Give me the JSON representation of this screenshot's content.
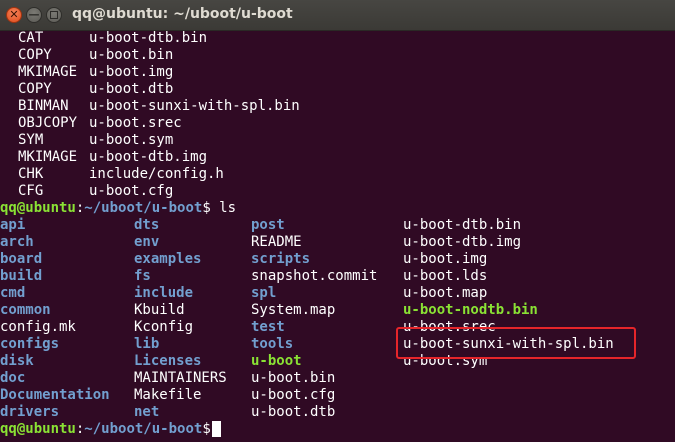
{
  "window": {
    "title": "qq@ubuntu: ~/uboot/u-boot",
    "close_glyph": "✕",
    "min_glyph": "—"
  },
  "build_output": [
    {
      "cmd": "CAT",
      "arg": "u-boot-dtb.bin"
    },
    {
      "cmd": "COPY",
      "arg": "u-boot.bin"
    },
    {
      "cmd": "MKIMAGE",
      "arg": "u-boot.img"
    },
    {
      "cmd": "COPY",
      "arg": "u-boot.dtb"
    },
    {
      "cmd": "BINMAN",
      "arg": "u-boot-sunxi-with-spl.bin"
    },
    {
      "cmd": "OBJCOPY",
      "arg": "u-boot.srec"
    },
    {
      "cmd": "SYM",
      "arg": "u-boot.sym"
    },
    {
      "cmd": "MKIMAGE",
      "arg": "u-boot-dtb.img"
    },
    {
      "cmd": "CHK",
      "arg": "include/config.h"
    },
    {
      "cmd": "CFG",
      "arg": "u-boot.cfg"
    }
  ],
  "prompt": {
    "user": "qq@ubuntu",
    "colon": ":",
    "path": "~/uboot/u-boot",
    "symbol": "$",
    "command": " ls"
  },
  "ls_rows": [
    [
      {
        "t": "api",
        "c": "blue"
      },
      {
        "t": "dts",
        "c": "blue"
      },
      {
        "t": "post",
        "c": "blue"
      },
      {
        "t": "u-boot-dtb.bin",
        "c": "white"
      }
    ],
    [
      {
        "t": "arch",
        "c": "blue"
      },
      {
        "t": "env",
        "c": "blue"
      },
      {
        "t": "README",
        "c": "white"
      },
      {
        "t": "u-boot-dtb.img",
        "c": "white"
      }
    ],
    [
      {
        "t": "board",
        "c": "blue"
      },
      {
        "t": "examples",
        "c": "blue"
      },
      {
        "t": "scripts",
        "c": "blue"
      },
      {
        "t": "u-boot.img",
        "c": "white"
      }
    ],
    [
      {
        "t": "build",
        "c": "blue"
      },
      {
        "t": "fs",
        "c": "blue"
      },
      {
        "t": "snapshot.commit",
        "c": "white"
      },
      {
        "t": "u-boot.lds",
        "c": "white"
      }
    ],
    [
      {
        "t": "cmd",
        "c": "blue"
      },
      {
        "t": "include",
        "c": "blue"
      },
      {
        "t": "spl",
        "c": "blue"
      },
      {
        "t": "u-boot.map",
        "c": "white"
      }
    ],
    [
      {
        "t": "common",
        "c": "blue"
      },
      {
        "t": "Kbuild",
        "c": "white"
      },
      {
        "t": "System.map",
        "c": "white"
      },
      {
        "t": "u-boot-nodtb.bin",
        "c": "green"
      }
    ],
    [
      {
        "t": "config.mk",
        "c": "white"
      },
      {
        "t": "Kconfig",
        "c": "white"
      },
      {
        "t": "test",
        "c": "blue"
      },
      {
        "t": "u-boot.srec",
        "c": "white"
      }
    ],
    [
      {
        "t": "configs",
        "c": "blue"
      },
      {
        "t": "lib",
        "c": "blue"
      },
      {
        "t": "tools",
        "c": "blue"
      },
      {
        "t": "u-boot-sunxi-with-spl.bin",
        "c": "white"
      }
    ],
    [
      {
        "t": "disk",
        "c": "blue"
      },
      {
        "t": "Licenses",
        "c": "blue"
      },
      {
        "t": "u-boot",
        "c": "green"
      },
      {
        "t": "u-boot.sym",
        "c": "white"
      }
    ],
    [
      {
        "t": "doc",
        "c": "blue"
      },
      {
        "t": "MAINTAINERS",
        "c": "white"
      },
      {
        "t": "u-boot.bin",
        "c": "white"
      },
      {
        "t": "",
        "c": "white"
      }
    ],
    [
      {
        "t": "Documentation",
        "c": "blue"
      },
      {
        "t": "Makefile",
        "c": "white"
      },
      {
        "t": "u-boot.cfg",
        "c": "white"
      },
      {
        "t": "",
        "c": "white"
      }
    ],
    [
      {
        "t": "drivers",
        "c": "blue"
      },
      {
        "t": "net",
        "c": "blue"
      },
      {
        "t": "u-boot.dtb",
        "c": "white"
      },
      {
        "t": "",
        "c": "white"
      }
    ]
  ],
  "colors": {
    "background": "#300a24",
    "directory": "#729fcf",
    "executable": "#8ae234",
    "highlight_box": "#e6252a"
  }
}
